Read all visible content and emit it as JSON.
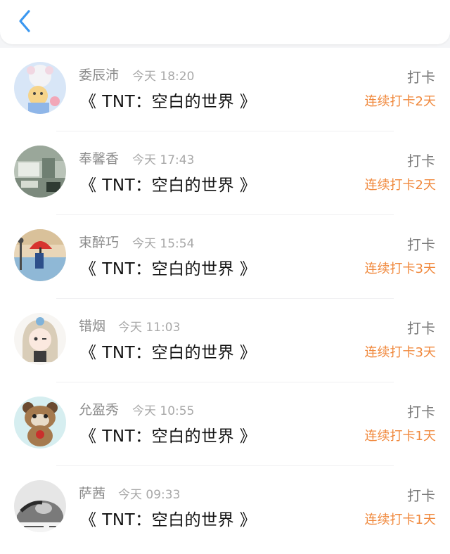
{
  "header": {
    "back_icon": "chevron-left-icon",
    "accent": "#3a97f0"
  },
  "colors": {
    "streak": "#f0883c",
    "name": "#8c8c8c",
    "title": "#111111"
  },
  "entries": [
    {
      "name": "委辰沛",
      "time": "今天 18:20",
      "title": "《 TNT：空白的世界 》",
      "action": "打卡",
      "streak": "连续打卡2天",
      "avatar": "cartoon-bear-avatar"
    },
    {
      "name": "奉馨香",
      "time": "今天 17:43",
      "title": "《 TNT：空白的世界 》",
      "action": "打卡",
      "streak": "连续打卡2天",
      "avatar": "room-photo-avatar"
    },
    {
      "name": "束醉巧",
      "time": "今天 15:54",
      "title": "《 TNT：空白的世界 》",
      "action": "打卡",
      "streak": "连续打卡3天",
      "avatar": "red-umbrella-avatar"
    },
    {
      "name": "错烟",
      "time": "今天 11:03",
      "title": "《 TNT：空白的世界 》",
      "action": "打卡",
      "streak": "连续打卡3天",
      "avatar": "anime-girl-avatar"
    },
    {
      "name": "允盈秀",
      "time": "今天 10:55",
      "title": "《 TNT：空白的世界 》",
      "action": "打卡",
      "streak": "连续打卡1天",
      "avatar": "raccoon-toy-avatar"
    },
    {
      "name": "萨茜",
      "time": "今天 09:33",
      "title": "《 TNT：空白的世界 》",
      "action": "打卡",
      "streak": "连续打卡1天",
      "avatar": "bw-portrait-avatar"
    }
  ]
}
